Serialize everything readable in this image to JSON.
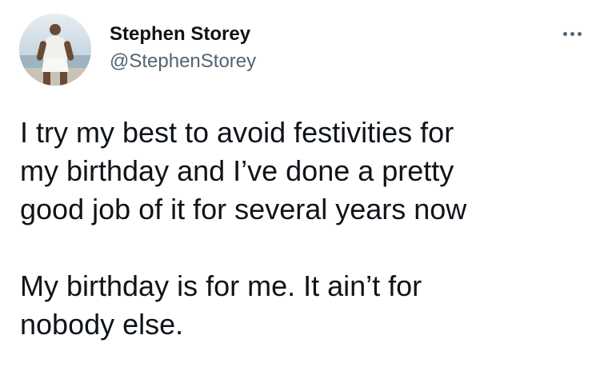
{
  "tweet": {
    "display_name": "Stephen Storey",
    "handle": "@StephenStorey",
    "more_icon": "more-horizontal-icon",
    "paragraph_1": [
      "I try my best to avoid festivities for",
      "my birthday and I’ve done a pretty",
      "good job of it for several years now"
    ],
    "paragraph_2": [
      "My birthday is for me. It ain’t for",
      "nobody else."
    ]
  },
  "colors": {
    "primary_text": "#0f1419",
    "secondary_text": "#536471",
    "background": "#ffffff"
  }
}
